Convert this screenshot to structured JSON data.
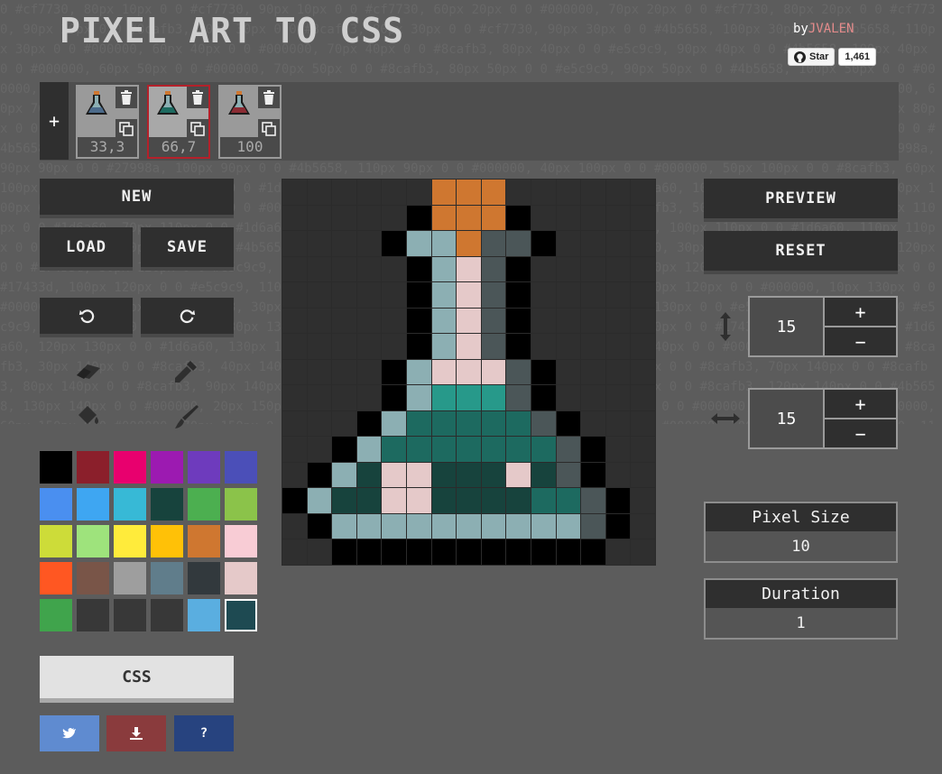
{
  "background_text": "0 #cf7730, 80px 10px 0 0 #cf7730, 90px 10px 0 0 #cf7730, 60px 20px 0 0 #000000, 70px 20px 0 0 #cf7730, 80px 20px 0 0 #cf7730, 90px 20px 0 0 #8cafb3, 70px 30px 0 0 #8cafb3, 80px 30px 0 0 #cf7730, 90px 30px 0 0 #4b5658, 100px 30px 0 0 #4b5658, 110px 30px 0 0 #000000, 60px 40px 0 0 #000000, 70px 40px 0 0 #8cafb3, 80px 40px 0 0 #e5c9c9, 90px 40px 0 0 #4b5658, 100px 40px 0 0 #000000, 60px 50px 0 0 #000000, 70px 50px 0 0 #8cafb3, 80px 50px 0 0 #e5c9c9, 90px 50px 0 0 #4b5658, 100px 50px 0 0 #000000, 60px 60px 0 0 #000000, 70px 60px 0 0 #8cafb3, 80px 60px 0 0 #e5c9c9, 90px 60px 0 0 #4b5658, 100px 60px 0 0 #000000, 60px 70px 0 0 #000000, 70px 70px 0 0 #8cafb3, 80px 70px 0 0 #e5c9c9, 90px 70px 0 0 #4b5658, 100px 70px 0 0 #000000, 50px 80px 0 0 #000000, 60px 80px 0 0 #8cafb3, 70px 80px 0 0 #e5c9c9, 80px 80px 0 0 #e5c9c9, 90px 80px 0 0 #e5c9c9, 100px 80px 0 0 #4b5658, 110px 80px 0 0 #000000, 50px 90px 0 0 #000000, 60px 90px 0 0 #8cafb3, 70px 90px 0 0 #27998a, 80px 90px 0 0 #27998a, 90px 90px 0 0 #27998a, 100px 90px 0 0 #4b5658, 110px 90px 0 0 #000000, 40px 100px 0 0 #000000, 50px 100px 0 0 #8cafb3, 60px 100px 0 0 #1d6a60, 70px 100px 0 0 #1d6a60, 80px 100px 0 0 #1d6a60, 90px 100px 0 0 #1d6a60, 100px 100px 0 0 #1d6a60, 110px 100px 0 0 #4b5658, 120px 100px 0 0 #000000, 30px 110px 0 0 #000000, 40px 110px 0 0 #8cafb3, 50px 110px 0 0 #1d6a60, 60px 110px 0 0 #1d6a60, 70px 110px 0 0 #1d6a60, 80px 110px 0 0 #1d6a60, 90px 110px 0 0 #1d6a60, 100px 110px 0 0 #1d6a60, 110px 110px 0 0 #1d6a60, 120px 110px 0 0 #4b5658, 130px 110px 0 0 #000000, 20px 120px 0 0 #000000, 30px 120px 0 0 #8cafb3, 40px 120px 0 0 #17433d, 50px 120px 0 0 #e5c9c9, 60px 120px 0 0 #e5c9c9, 70px 120px 0 0 #17433d, 80px 120px 0 0 #17433d, 90px 120px 0 0 #17433d, 100px 120px 0 0 #e5c9c9, 110px 120px 0 0 #17433d, 120px 120px 0 0 #4b5658, 130px 120px 0 0 #000000, 10px 130px 0 0 #000000, 20px 130px 0 0 #8cafb3, 30px 130px 0 0 #17433d, 40px 130px 0 0 #17433d, 50px 130px 0 0 #e5c9c9, 60px 130px 0 0 #e5c9c9, 70px 130px 0 0 #17433d, 80px 130px 0 0 #17433d, 90px 130px 0 0 #17433d, 100px 130px 0 0 #17433d, 110px 130px 0 0 #1d6a60, 120px 130px 0 0 #1d6a60, 130px 130px 0 0 #4b5658, 140px 130px 0 0 #000000, 10px 140px 0 0 #000000, 20px 140px 0 0 #8cafb3, 30px 140px 0 0 #8cafb3, 40px 140px 0 0 #8cafb3, 50px 140px 0 0 #8cafb3, 60px 140px 0 0 #8cafb3, 70px 140px 0 0 #8cafb3, 80px 140px 0 0 #8cafb3, 90px 140px 0 0 #8cafb3, 100px 140px 0 0 #8cafb3, 110px 140px 0 0 #8cafb3, 120px 140px 0 0 #4b5658, 130px 140px 0 0 #000000, 20px 150px 0 0 #000000, 30px 150px 0 0 #000000, 40px 150px 0 0 #000000, 50px 150px 0 0 #000000, 60px 150px 0 0 #000000, 70px 150px 0 0 #000000, 80px 150px 0 0 #000000, 90px 150px 0 0 #000000, 100px 150px 0 0 #000000, 110px 150px 0 0 #000000, 120px 150px 0 0 #000000",
  "header": {
    "title": "PIXEL ART TO CSS",
    "by_prefix": "by",
    "author": "JVALEN"
  },
  "github": {
    "star_label": "Star",
    "star_count": "1,461"
  },
  "frames": {
    "add_label": "+",
    "items": [
      {
        "percent": "33,3",
        "active": false
      },
      {
        "percent": "66,7",
        "active": true
      },
      {
        "percent": "100",
        "active": false
      }
    ]
  },
  "buttons": {
    "new": "NEW",
    "load": "LOAD",
    "save": "SAVE",
    "preview": "PREVIEW",
    "reset": "RESET",
    "css": "CSS"
  },
  "dimensions": {
    "height": "15",
    "width": "15",
    "plus": "+",
    "minus": "−"
  },
  "pixel_size": {
    "label": "Pixel Size",
    "value": "10"
  },
  "duration": {
    "label": "Duration",
    "value": "1"
  },
  "palette": {
    "selected_index": 29,
    "colors": [
      "#000000",
      "#8b1f2b",
      "#e8006e",
      "#9c1ab1",
      "#6e3bbd",
      "#4b4fb8",
      "#4a8ff0",
      "#3ea6f2",
      "#37b9d6",
      "#17433d",
      "#4caf50",
      "#8bc34a",
      "#cddc39",
      "#9ee37c",
      "#ffeb3b",
      "#ffc107",
      "#cf7730",
      "#f8ccd5",
      "#ff5722",
      "#795548",
      "#9e9e9e",
      "#607d8b",
      "#32393d",
      "#e5c9c9",
      "#40a44c",
      "#383838",
      "#383838",
      "#383838",
      "#5aaee0",
      "#1e4a52"
    ]
  },
  "canvas": {
    "colors": {
      "K": "#000000",
      "O": "#cf7730",
      "B": "#8cafb3",
      "G": "#4b5658",
      "P": "#e5c9c9",
      "T": "#27998a",
      "M": "#1d6a60",
      "D": "#17433d",
      ".": "#2f2f2f"
    },
    "rows": [
      "......OOO......",
      ".....KOOOK.....",
      "....KBBOGGK....",
      ".....KBPGK.....",
      ".....KBPGK.....",
      ".....KBPGK.....",
      ".....KBPGK.....",
      "....KBPPPGK....",
      "....KBTTTGK....",
      "...KBMMMMMGK...",
      "..KBMMMMMMMGK..",
      ".KBDPPDDDPDGK..",
      "KBDDPPDDDDMMGK.",
      ".KBBBBBBBBBBGK.",
      "..KKKKKKKKKKK.."
    ]
  },
  "icons": {
    "eraser": "eraser-icon",
    "eyedropper": "eyedropper-icon",
    "bucket": "paint-bucket-icon",
    "brush": "brush-icon",
    "undo": "undo-icon",
    "redo": "redo-icon",
    "twitter": "twitter-icon",
    "download": "download-icon",
    "help": "?"
  },
  "footer_colors": {
    "twitter": "#5f8bd0",
    "download": "#8a3b3d",
    "help": "#27437f"
  }
}
